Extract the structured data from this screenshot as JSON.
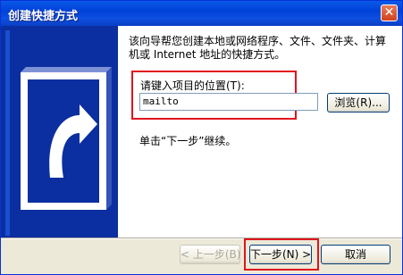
{
  "window": {
    "title": "创建快捷方式",
    "close_glyph": "✕"
  },
  "content": {
    "description": "该向导帮您创建本地或网络程序、文件、文件夹、计算机或 Internet 地址的快捷方式。",
    "prompt_label": "请键入项目的位置(T):",
    "location_value": "mailto",
    "browse_label": "浏览(R)...",
    "hint": "单击“下一步”继续。"
  },
  "buttons": {
    "back_label": "< 上一步(B)",
    "next_label": "下一步(N) >",
    "cancel_label": "取消"
  },
  "colors": {
    "title_bar": "#0a5ae8",
    "graphic_bg": "#0b2fa0",
    "highlight": "#e0141c"
  }
}
